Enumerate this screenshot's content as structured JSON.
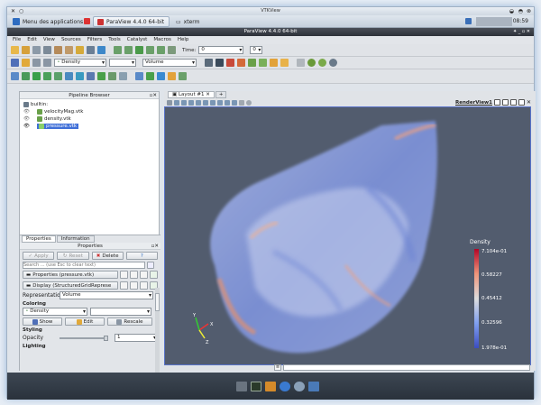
{
  "outer_window": {
    "title": "VTKView"
  },
  "taskbar": {
    "apps_menu": "Menu des applications",
    "task1": "ParaView 4.4.0 64-bit",
    "task2": "xterm",
    "clock": "08:59"
  },
  "app": {
    "title": "ParaView 4.4.0 64-bit"
  },
  "menu": [
    "File",
    "Edit",
    "View",
    "Sources",
    "Filters",
    "Tools",
    "Catalyst",
    "Macros",
    "Help"
  ],
  "toolbar1": {
    "time_label": "Time:",
    "time_value": "0",
    "time_step": "0"
  },
  "toolbar2": {
    "color_by": "Density",
    "component": "",
    "representation": "Volume"
  },
  "pipeline": {
    "title": "Pipeline Browser",
    "items": [
      "builtin:",
      "velocityMag.vtk",
      "density.vtk",
      "pressure.vtk"
    ]
  },
  "properties": {
    "tabs": [
      "Properties",
      "Information"
    ],
    "header": "Properties",
    "apply": "Apply",
    "reset": "Reset",
    "delete": "Delete",
    "help": "?",
    "search_placeholder": "Search ... (use Esc to clear text)",
    "section_props": "Properties (pressure.vtk)",
    "section_display": "Display (StructuredGridReprese",
    "representation_label": "Representation",
    "representation_value": "Volume",
    "coloring_label": "Coloring",
    "coloring_value": "Density",
    "show": "Show",
    "edit": "Edit",
    "rescale": "Rescale",
    "styling_label": "Styling",
    "opacity_label": "Opacity",
    "opacity_value": "1",
    "lighting_label": "Lighting"
  },
  "view": {
    "tab": "Layout #1",
    "render_view_label": "RenderView1"
  },
  "legend": {
    "title": "Density",
    "labels": [
      "7.104e-01",
      "0.58227",
      "0.45412",
      "0.32596",
      "1.978e-01"
    ]
  },
  "colors": {
    "accent": "#3f6fd8",
    "render_bg": "#525c6e"
  }
}
